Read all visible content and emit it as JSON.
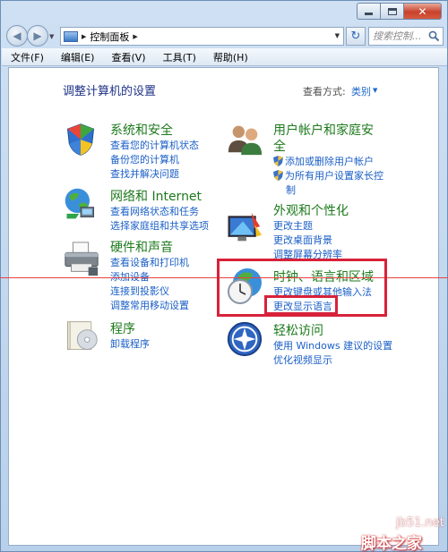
{
  "window": {
    "nav": {
      "address_root_label": "控制面板",
      "search_placeholder": "搜索控制..."
    },
    "menu": [
      "文件(F)",
      "编辑(E)",
      "查看(V)",
      "工具(T)",
      "帮助(H)"
    ]
  },
  "content": {
    "page_title": "调整计算机的设置",
    "view_by_label": "查看方式:",
    "view_by_value": "类别"
  },
  "categories": {
    "system": {
      "title": "系统和安全",
      "links": [
        "查看您的计算机状态",
        "备份您的计算机",
        "查找并解决问题"
      ]
    },
    "network": {
      "title": "网络和 Internet",
      "links": [
        "查看网络状态和任务",
        "选择家庭组和共享选项"
      ]
    },
    "hardware": {
      "title": "硬件和声音",
      "links": [
        "查看设备和打印机",
        "添加设备",
        "连接到投影仪",
        "调整常用移动设置"
      ]
    },
    "programs": {
      "title": "程序",
      "links": [
        "卸载程序"
      ]
    },
    "users": {
      "title_line1": "用户帐户和家庭安",
      "title_line2": "全",
      "links": [
        "添加或删除用户帐户",
        "为所有用户设置家长控",
        "制"
      ]
    },
    "appearance": {
      "title": "外观和个性化",
      "links": [
        "更改主题",
        "更改桌面背景",
        "调整屏幕分辨率"
      ]
    },
    "clock": {
      "title": "时钟、语言和区域",
      "links": [
        "更改键盘或其他输入法",
        "更改显示语言"
      ]
    },
    "ease": {
      "title": "轻松访问",
      "links": [
        "使用 Windows 建议的设置",
        "优化视频显示"
      ]
    }
  },
  "watermark": {
    "site": "jb51.net",
    "name": "脚本之家"
  },
  "colors": {
    "category_title": "#1d7a1d",
    "link": "#1b5fc7",
    "highlight": "#d7223a"
  }
}
